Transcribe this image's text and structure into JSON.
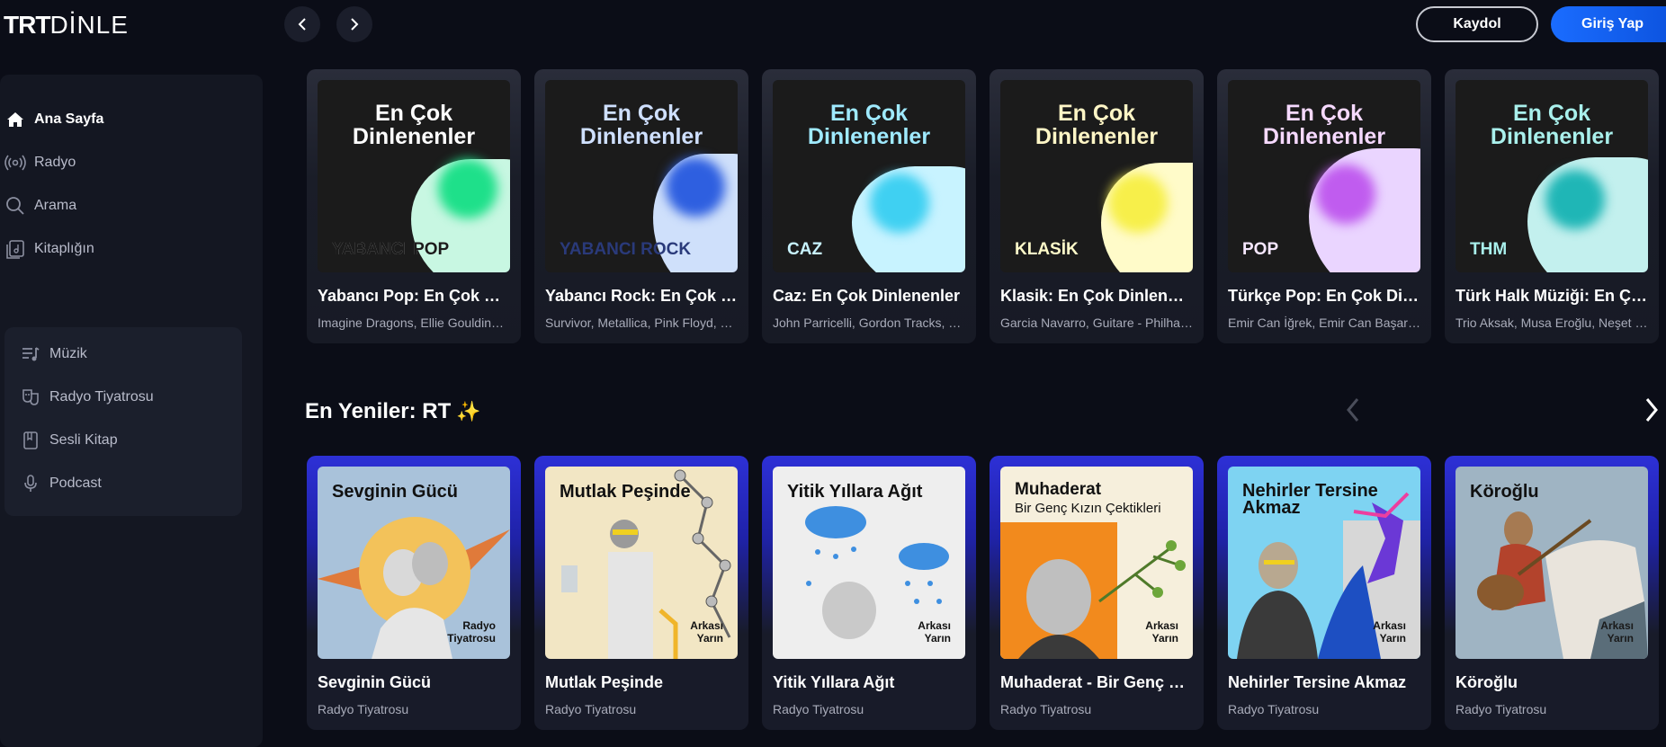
{
  "logo": {
    "bold": "TRT",
    "light": "DİNLE"
  },
  "header": {
    "signup": "Kaydol",
    "login": "Giriş Yap"
  },
  "sidebar": {
    "main": [
      {
        "label": "Ana Sayfa",
        "icon": "home-icon",
        "active": true
      },
      {
        "label": "Radyo",
        "icon": "radio-icon"
      },
      {
        "label": "Arama",
        "icon": "search-icon"
      },
      {
        "label": "Kitaplığın",
        "icon": "library-icon"
      }
    ],
    "categories": [
      {
        "label": "Müzik",
        "icon": "music-icon"
      },
      {
        "label": "Radyo Tiyatrosu",
        "icon": "theater-icon"
      },
      {
        "label": "Sesli Kitap",
        "icon": "book-icon"
      },
      {
        "label": "Podcast",
        "icon": "microphone-icon"
      }
    ]
  },
  "playlists": {
    "heading": "En Çok Dinlenenler",
    "items": [
      {
        "cover_label": "YABANCI POP",
        "title": "Yabancı Pop: En Çok Dinlenenler",
        "artists": "Imagine Dragons, Ellie Goulding, Dua Lipa",
        "head_color": "#ffffff",
        "blob_color": "#c8f7e2",
        "dot_color": "#1ee08a"
      },
      {
        "cover_label": "YABANCI ROCK",
        "title": "Yabancı Rock: En Çok Dinlenenler",
        "artists": "Survivor, Metallica, Pink Floyd, Queen",
        "head_color": "#cfe0ff",
        "blob_color": "#cfe0fb",
        "dot_color": "#2e5fe0"
      },
      {
        "cover_label": "CAZ",
        "title": "Caz: En Çok Dinlenenler",
        "artists": "John Parricelli, Gordon Tracks, Miles Davis",
        "head_color": "#9feaff",
        "blob_color": "#c8f3ff",
        "dot_color": "#3fd0f2"
      },
      {
        "cover_label": "KLASİK",
        "title": "Klasik: En Çok Dinlenenler",
        "artists": "Garcia Navarro, Guitare - Philharmonia",
        "head_color": "#fff6c6",
        "blob_color": "#fffbc9",
        "dot_color": "#f7ef4a"
      },
      {
        "cover_label": "POP",
        "title": "Türkçe Pop: En Çok Dinlenenler",
        "artists": "Emir Can İğrek, Emir Can Başaran, Sezen Aksu",
        "head_color": "#f6d9ff",
        "blob_color": "#ead5ff",
        "dot_color": "#c05cef"
      },
      {
        "cover_label": "THM",
        "title": "Türk Halk Müziği: En Çok Dinlenenler",
        "artists": "Trio Aksak, Musa Eroğlu, Neşet Ertaş",
        "head_color": "#a9f0ec",
        "blob_color": "#c3f0ee",
        "dot_color": "#1fb6b6"
      }
    ]
  },
  "section": {
    "title": "En Yeniler: RT",
    "emoji": "✨"
  },
  "dramas": [
    {
      "cover_title": "Sevginin Gücü",
      "cover_sub": "",
      "tag": "Radyo\nTiyatrosu",
      "title": "Sevginin Gücü",
      "subtitle": "Radyo Tiyatrosu",
      "bg": "#a9c2da"
    },
    {
      "cover_title": "Mutlak Peşinde",
      "cover_sub": "",
      "tag": "Arkası\nYarın",
      "title": "Mutlak Peşinde",
      "subtitle": "Radyo Tiyatrosu",
      "bg": "#f2e6c4"
    },
    {
      "cover_title": "Yitik Yıllara Ağıt",
      "cover_sub": "",
      "tag": "Arkası\nYarın",
      "title": "Yitik Yıllara Ağıt",
      "subtitle": "Radyo Tiyatrosu",
      "bg": "#eeeeee"
    },
    {
      "cover_title": "Muhaderat",
      "cover_sub": "Bir Genç Kızın Çektikleri",
      "tag": "Arkası\nYarın",
      "title": "Muhaderat - Bir Genç Kızın Çektikleri",
      "subtitle": "Radyo Tiyatrosu",
      "bg": "#f6efdc"
    },
    {
      "cover_title": "Nehirler Tersine\nAkmaz",
      "cover_sub": "",
      "tag": "Arkası\nYarın",
      "title": "Nehirler Tersine Akmaz",
      "subtitle": "Radyo Tiyatrosu",
      "bg": "#7ed3f2"
    },
    {
      "cover_title": "Köroğlu",
      "cover_sub": "",
      "tag": "Arkası\nYarın",
      "title": "Köroğlu",
      "subtitle": "Radyo Tiyatrosu",
      "bg": "#9fb4c3"
    }
  ]
}
